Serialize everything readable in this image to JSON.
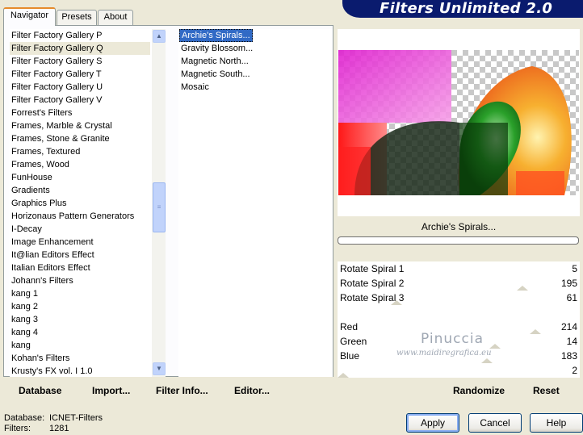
{
  "banner": {
    "title": "Filters Unlimited 2.0"
  },
  "tabs": [
    "Navigator",
    "Presets",
    "About"
  ],
  "categories": [
    "Filter Factory Gallery P",
    "Filter Factory Gallery Q",
    "Filter Factory Gallery S",
    "Filter Factory Gallery T",
    "Filter Factory Gallery U",
    "Filter Factory Gallery V",
    "Forrest's Filters",
    "Frames, Marble & Crystal",
    "Frames, Stone & Granite",
    "Frames, Textured",
    "Frames, Wood",
    "FunHouse",
    "Gradients",
    "Graphics Plus",
    "Horizonaus Pattern Generators",
    "I-Decay",
    "Image Enhancement",
    "It@lian Editors Effect",
    "Italian Editors Effect",
    "Johann's Filters",
    "kang 1",
    "kang 2",
    "kang 3",
    "kang 4",
    "kang",
    "Kohan's Filters",
    "Krusty's FX vol. I 1.0"
  ],
  "selected_category": "Filter Factory Gallery Q",
  "filters": [
    "Archie's Spirals...",
    "Gravity Blossom...",
    "Magnetic North...",
    "Magnetic South...",
    "Mosaic"
  ],
  "selected_filter": "Archie's Spirals...",
  "left_buttons": {
    "database": "Database",
    "import": "Import...",
    "filter_info": "Filter Info...",
    "editor": "Editor..."
  },
  "preview": {
    "filter_name": "Archie's Spirals..."
  },
  "params": [
    {
      "label": "Rotate Spiral 1",
      "value": "5"
    },
    {
      "label": "Rotate Spiral 2",
      "value": "195"
    },
    {
      "label": "Rotate Spiral 3",
      "value": "61"
    },
    {
      "label": "",
      "value": ""
    },
    {
      "label": "Red",
      "value": "214"
    },
    {
      "label": "Green",
      "value": "14"
    },
    {
      "label": "Blue",
      "value": "183"
    },
    {
      "label": "",
      "value": "2"
    }
  ],
  "right_buttons": {
    "randomize": "Randomize",
    "reset": "Reset"
  },
  "watermark": {
    "line1": "Pinuccia",
    "line2": "www.maidiregrafica.eu"
  },
  "status": {
    "database_label": "Database:",
    "database_value": "ICNET-Filters",
    "filters_label": "Filters:",
    "filters_value": "1281"
  },
  "dialog_buttons": {
    "apply": "Apply",
    "cancel": "Cancel",
    "help": "Help"
  },
  "icons": {
    "scroll_up": "chevron-up-icon",
    "scroll_down": "chevron-down-icon",
    "scroll_grip": "grip-icon"
  },
  "colors": {
    "banner": "#0a1b6e",
    "selection": "#316ac5",
    "category_highlight": "#ece9d8"
  }
}
